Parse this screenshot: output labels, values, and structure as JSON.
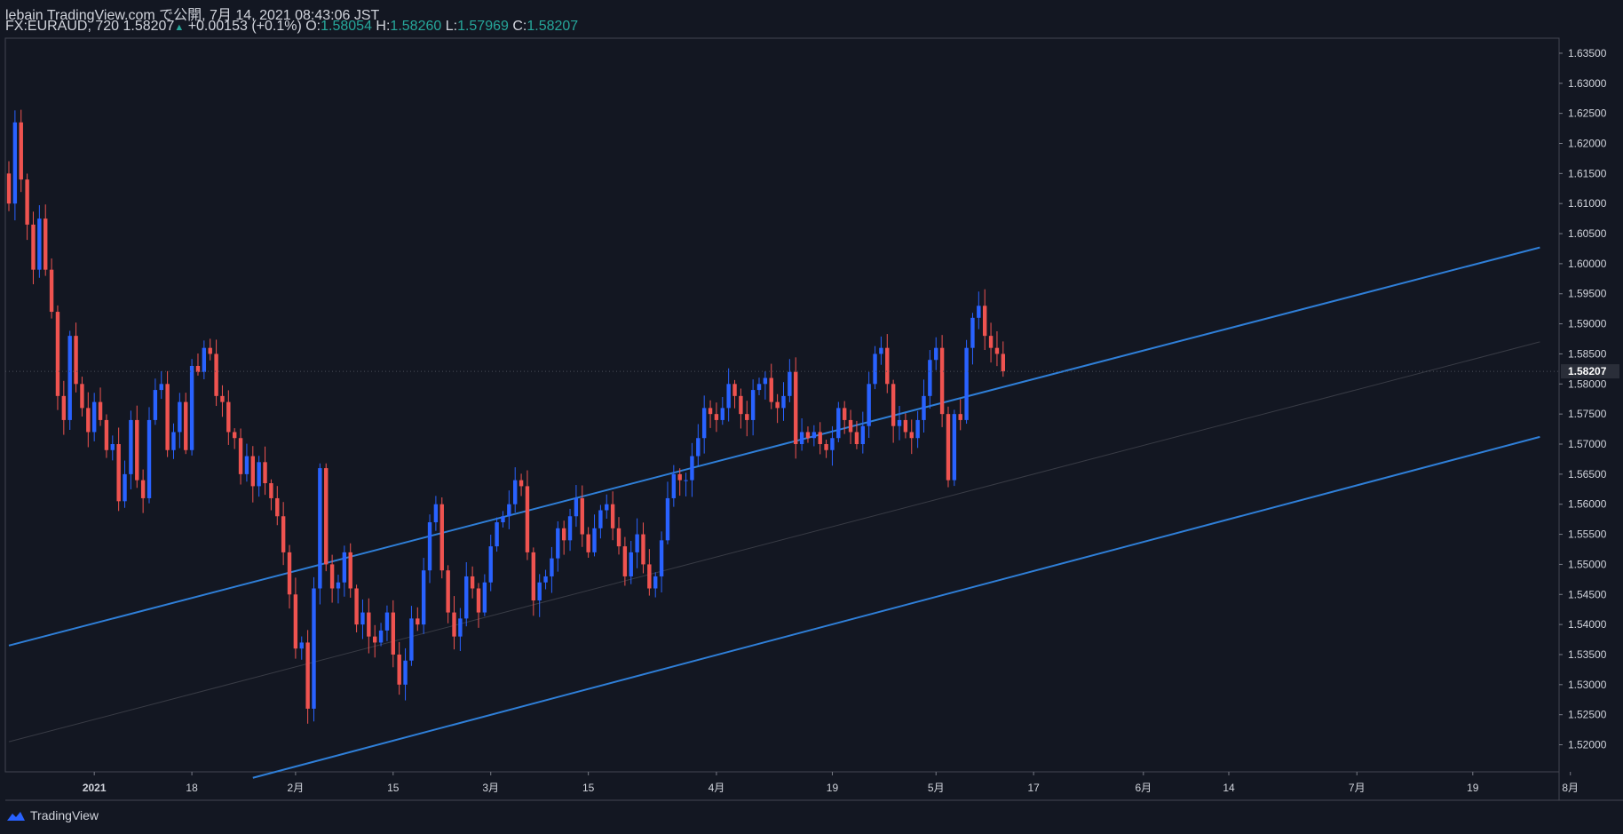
{
  "header": {
    "line1": "lebain TradingView.com で公開, 7月 14, 2021 08:43:06 JST",
    "symbol": "FX:EURAUD, 720",
    "last": "1.58207",
    "change": "+0.00153 (+0.1%)",
    "o_label": "O:",
    "o_value": "1.58054",
    "h_label": "H:",
    "h_value": "1.58260",
    "l_label": "L:",
    "l_value": "1.57969",
    "c_label": "C:",
    "c_value": "1.58207"
  },
  "footer": {
    "brand": "TradingView"
  },
  "colors": {
    "background": "#131722",
    "up": "#2962ff",
    "down": "#ef5350",
    "channel": "#2f7fd8",
    "text": "#d1d4dc"
  },
  "chart_data": {
    "type": "candlestick",
    "ylim": [
      1.5155,
      1.6375
    ],
    "y_ticks": [
      "1.63500",
      "1.63000",
      "1.62500",
      "1.62000",
      "1.61500",
      "1.61000",
      "1.60500",
      "1.60000",
      "1.59500",
      "1.59000",
      "1.58500",
      "1.58000",
      "1.57500",
      "1.57000",
      "1.56500",
      "1.56000",
      "1.55500",
      "1.55000",
      "1.54500",
      "1.54000",
      "1.53500",
      "1.53000",
      "1.52500",
      "1.52000"
    ],
    "last_price_label": "1.58207",
    "x_labels": [
      {
        "text": "2021",
        "bar": 14,
        "bold": true
      },
      {
        "text": "18",
        "bar": 30
      },
      {
        "text": "2月",
        "bar": 47
      },
      {
        "text": "15",
        "bar": 63
      },
      {
        "text": "3月",
        "bar": 79
      },
      {
        "text": "15",
        "bar": 95
      },
      {
        "text": "4月",
        "bar": 116
      },
      {
        "text": "19",
        "bar": 135
      },
      {
        "text": "5月",
        "bar": 152
      },
      {
        "text": "17",
        "bar": 168
      },
      {
        "text": "6月",
        "bar": 186
      },
      {
        "text": "14",
        "bar": 200
      },
      {
        "text": "7月",
        "bar": 221
      },
      {
        "text": "19",
        "bar": 240
      },
      {
        "text": "8月",
        "bar": 256
      }
    ],
    "closes": [
      1.61,
      1.6235,
      1.614,
      1.6065,
      1.599,
      1.6075,
      1.599,
      1.592,
      1.578,
      1.574,
      1.588,
      1.58,
      1.576,
      1.572,
      1.577,
      1.574,
      1.569,
      1.57,
      1.5605,
      1.565,
      1.574,
      1.564,
      1.561,
      1.574,
      1.579,
      1.58,
      1.569,
      1.572,
      1.577,
      1.569,
      1.583,
      1.582,
      1.586,
      1.585,
      1.578,
      1.577,
      1.572,
      1.571,
      1.565,
      1.568,
      1.563,
      1.567,
      1.5635,
      1.561,
      1.558,
      1.552,
      1.545,
      1.536,
      1.537,
      1.526,
      1.546,
      1.566,
      1.55,
      1.546,
      1.547,
      1.552,
      1.546,
      1.54,
      1.542,
      1.538,
      1.537,
      1.539,
      1.542,
      1.535,
      1.53,
      1.534,
      1.541,
      1.54,
      1.549,
      1.557,
      1.56,
      1.549,
      1.542,
      1.538,
      1.541,
      1.548,
      1.546,
      1.542,
      1.547,
      1.553,
      1.557,
      1.558,
      1.56,
      1.564,
      1.563,
      1.552,
      1.544,
      1.547,
      1.548,
      1.551,
      1.556,
      1.554,
      1.558,
      1.561,
      1.555,
      1.552,
      1.556,
      1.559,
      1.56,
      1.556,
      1.553,
      1.548,
      1.552,
      1.555,
      1.55,
      1.546,
      1.548,
      1.554,
      1.561,
      1.565,
      1.564,
      1.564,
      1.568,
      1.571,
      1.576,
      1.575,
      1.574,
      1.576,
      1.58,
      1.578,
      1.575,
      1.574,
      1.579,
      1.58,
      1.581,
      1.577,
      1.576,
      1.578,
      1.582,
      1.57,
      1.572,
      1.571,
      1.572,
      1.57,
      1.569,
      1.571,
      1.576,
      1.574,
      1.572,
      1.57,
      1.573,
      1.58,
      1.585,
      1.586,
      1.58,
      1.573,
      1.574,
      1.572,
      1.571,
      1.574,
      1.578,
      1.584,
      1.586,
      1.575,
      1.564,
      1.575,
      1.574,
      1.586,
      1.591,
      1.593,
      1.588,
      1.586,
      1.585,
      1.5821
    ],
    "channel": {
      "upper": [
        {
          "bar": 0,
          "price": 1.5365
        },
        {
          "bar": 251,
          "price": 1.6027
        }
      ],
      "lower": [
        {
          "bar": 40,
          "price": 1.5145
        },
        {
          "bar": 251,
          "price": 1.5712
        }
      ],
      "median": [
        {
          "bar": 0,
          "price": 1.5205
        },
        {
          "bar": 251,
          "price": 1.587
        }
      ]
    }
  }
}
